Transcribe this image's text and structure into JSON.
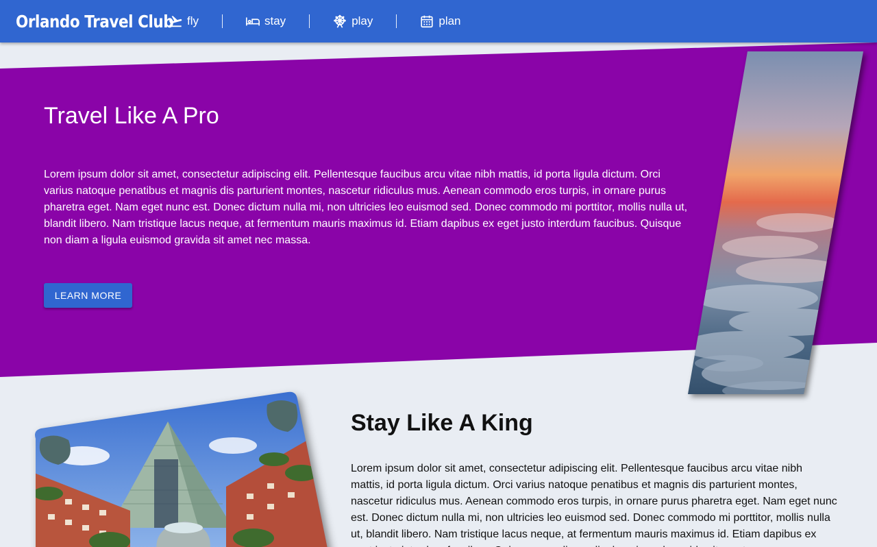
{
  "brand": "Orlando Travel Club",
  "nav": [
    {
      "label": "fly",
      "icon": "airplane-takeoff-icon"
    },
    {
      "label": "stay",
      "icon": "bed-icon"
    },
    {
      "label": "play",
      "icon": "ferris-wheel-icon"
    },
    {
      "label": "plan",
      "icon": "calendar-icon"
    }
  ],
  "hero": {
    "title": "Travel Like A Pro",
    "text": "Lorem ipsum dolor sit amet, consectetur adipiscing elit. Pellentesque faucibus arcu vitae nibh mattis, id porta ligula dictum. Orci varius natoque penatibus et magnis dis parturient montes, nascetur ridiculus mus. Aenean commodo eros turpis, in ornare purus pharetra eget. Nam eget nunc est. Donec dictum nulla mi, non ultricies leo euismod sed. Donec commodo mi porttitor, mollis nulla ut, blandit libero. Nam tristique lacus neque, at fermentum mauris maximus id. Etiam dapibus ex eget justo interdum faucibus. Quisque non diam a ligula euismod gravida sit amet nec massa.",
    "button": "LEARN MORE",
    "image": "sunset-clouds-image",
    "color": "#8a04a8"
  },
  "stay": {
    "title": "Stay Like A King",
    "text": "Lorem ipsum dolor sit amet, consectetur adipiscing elit. Pellentesque faucibus arcu vitae nibh mattis, id porta ligula dictum. Orci varius natoque penatibus et magnis dis parturient montes, nascetur ridiculus mus. Aenean commodo eros turpis, in ornare purus pharetra eget. Nam eget nunc est. Donec dictum nulla mi, non ultricies leo euismod sed. Donec commodo mi porttitor, mollis nulla ut, blandit libero. Nam tristique lacus neque, at fermentum mauris maximus id. Etiam dapibus ex eget justo interdum faucibus. Quisque non diam a ligula euismod gravida sit amet nec massa.",
    "image": "hotel-resort-image"
  },
  "colors": {
    "primary": "#3066d0",
    "hero_bg": "#8a04a8",
    "page_bg": "#e9edf3"
  }
}
